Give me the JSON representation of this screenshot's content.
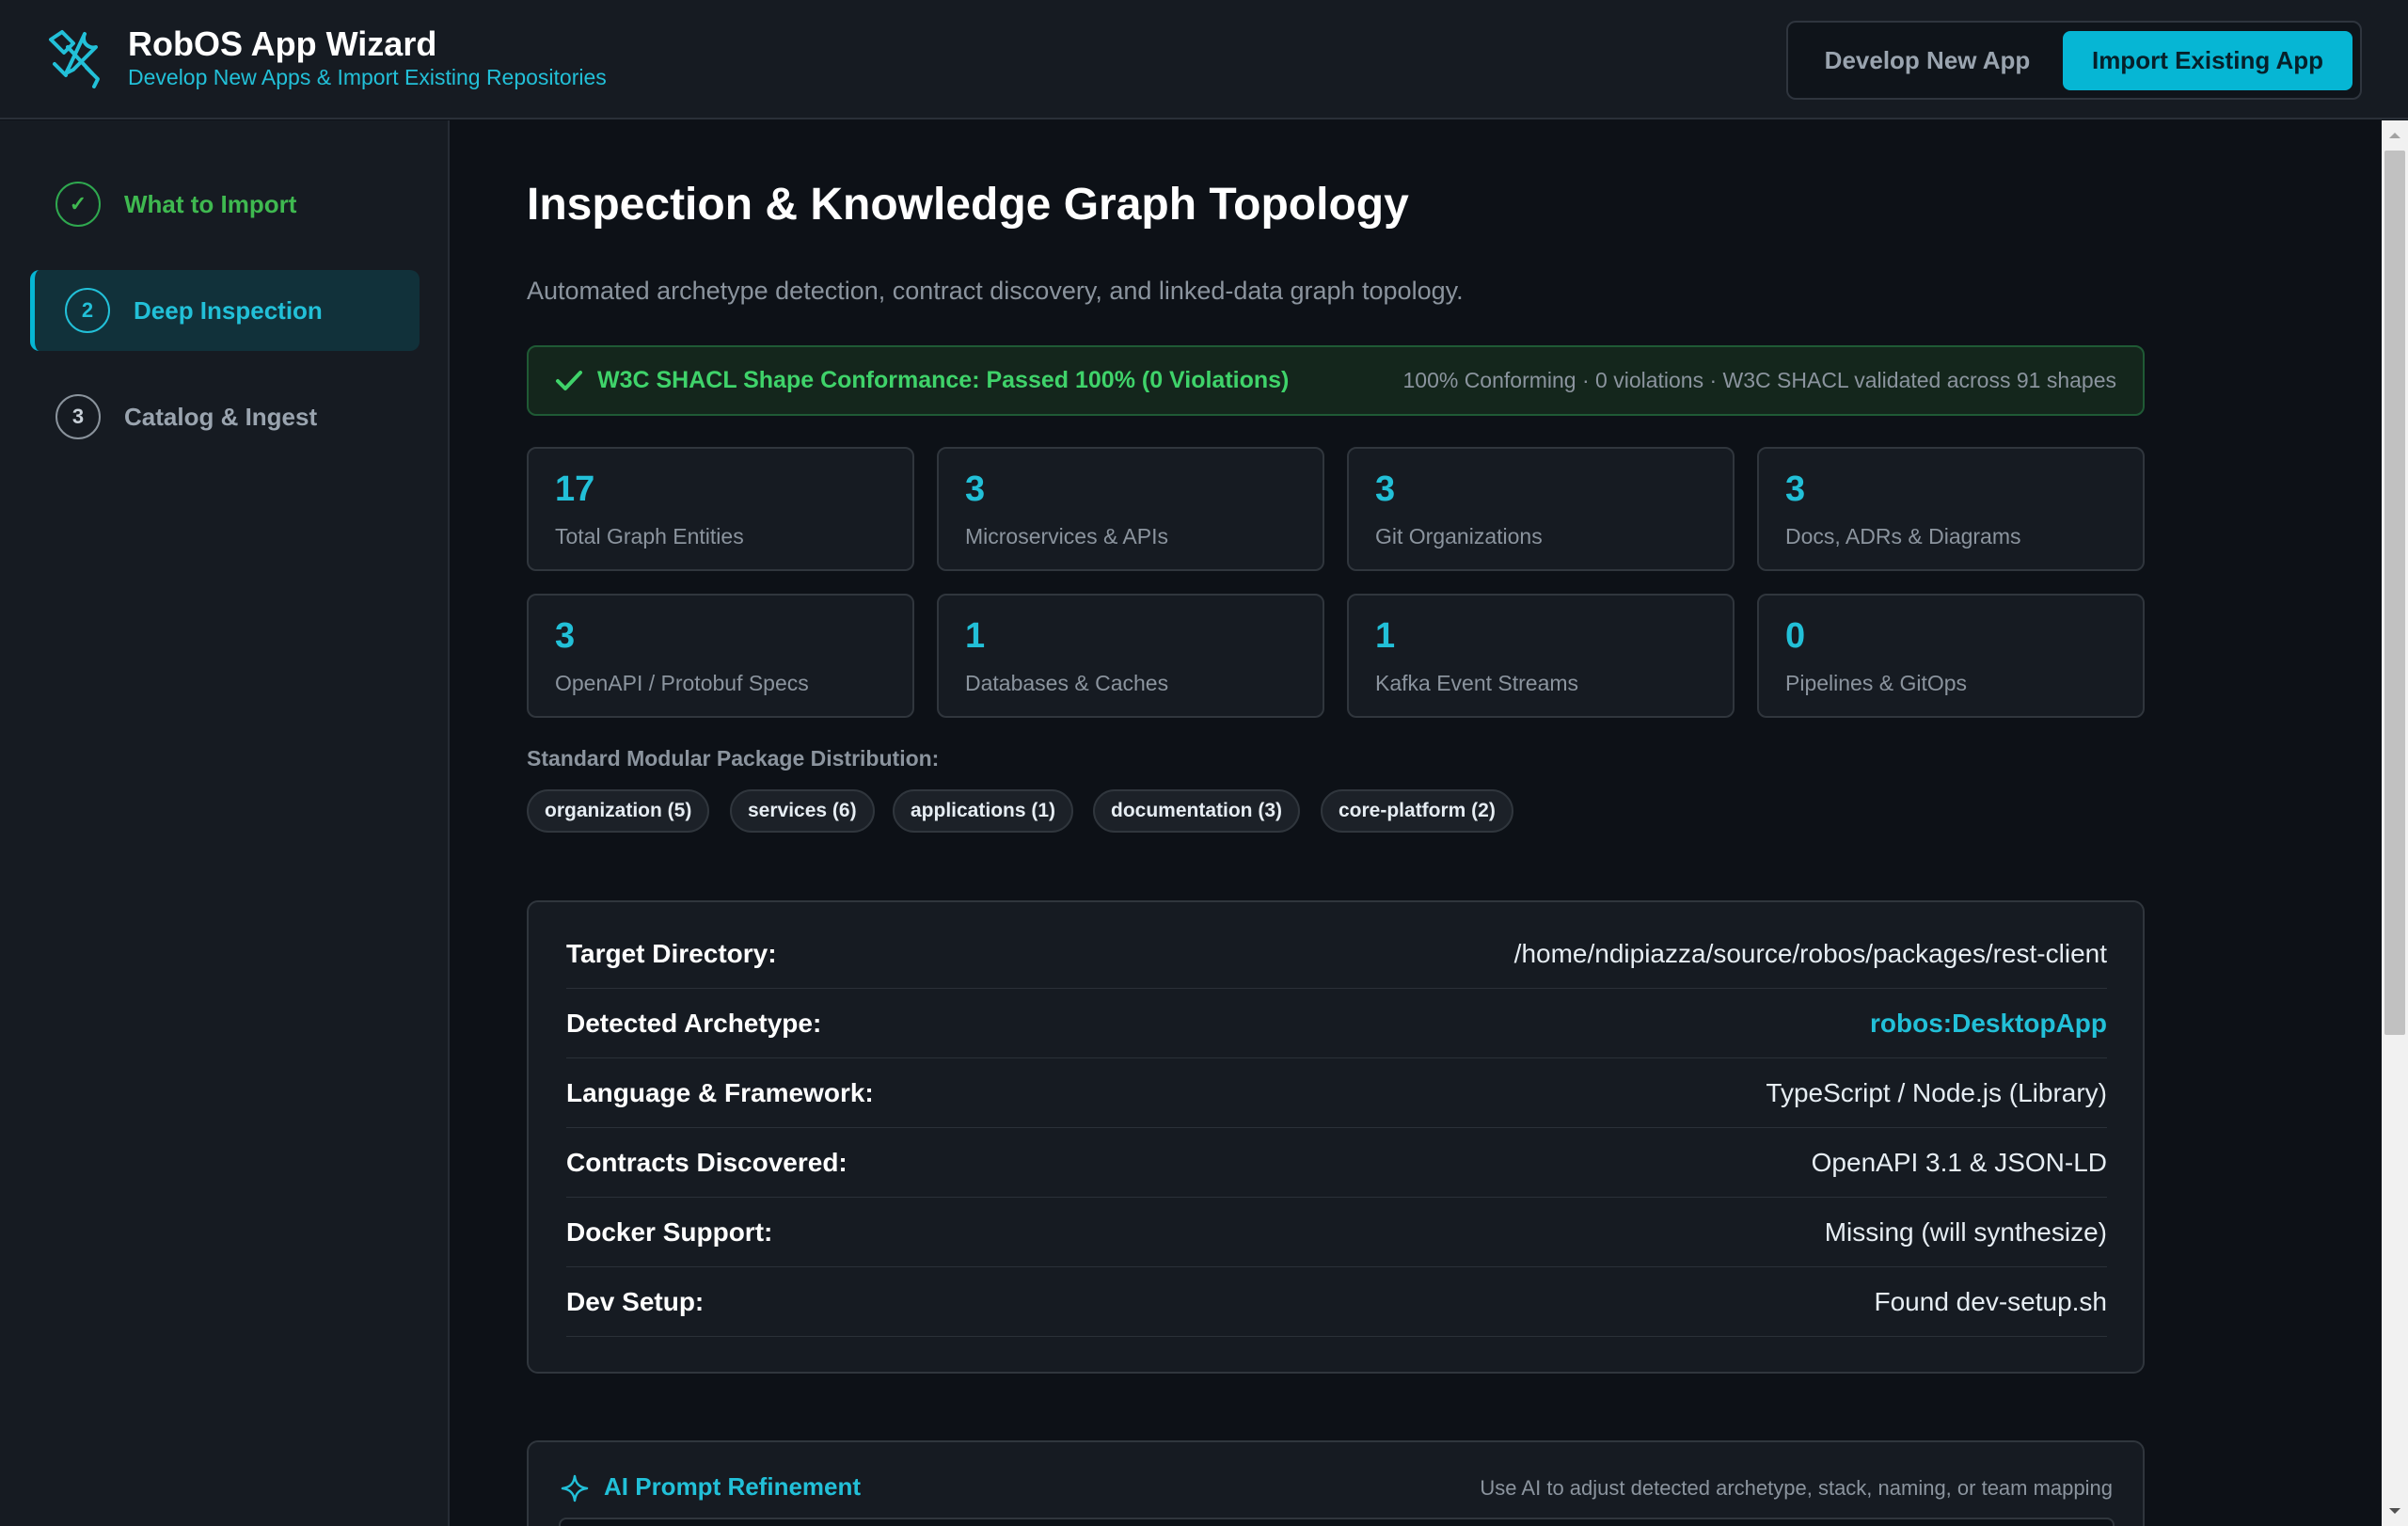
{
  "header": {
    "title": "RobOS App Wizard",
    "subtitle": "Develop New Apps & Import Existing Repositories",
    "modes": {
      "develop_label": "Develop New App",
      "import_label": "Import Existing App",
      "active": "import"
    },
    "logo_icon": "tools-icon"
  },
  "sidebar": {
    "steps": [
      {
        "marker": "✓",
        "label": "What to Import",
        "state": "done"
      },
      {
        "marker": "2",
        "label": "Deep Inspection",
        "state": "active"
      },
      {
        "marker": "3",
        "label": "Catalog & Ingest",
        "state": "pending"
      }
    ]
  },
  "main": {
    "title": "Inspection & Knowledge Graph Topology",
    "description": "Automated archetype detection, contract discovery, and linked-data graph topology.",
    "shacl": {
      "title": "W3C SHACL Shape Conformance: Passed 100% (0 Violations)",
      "meta": "100% Conforming · 0 violations · W3C SHACL validated across 91 shapes"
    },
    "stats": [
      {
        "value": "17",
        "label": "Total Graph Entities"
      },
      {
        "value": "3",
        "label": "Microservices & APIs"
      },
      {
        "value": "3",
        "label": "Git Organizations"
      },
      {
        "value": "3",
        "label": "Docs, ADRs & Diagrams"
      },
      {
        "value": "3",
        "label": "OpenAPI / Protobuf Specs"
      },
      {
        "value": "1",
        "label": "Databases & Caches"
      },
      {
        "value": "1",
        "label": "Kafka Event Streams"
      },
      {
        "value": "0",
        "label": "Pipelines & GitOps"
      }
    ],
    "distribution": {
      "title": "Standard Modular Package Distribution:",
      "packages": [
        "organization (5)",
        "services (6)",
        "applications (1)",
        "documentation (3)",
        "core-platform (2)"
      ]
    },
    "details": [
      {
        "key": "Target Directory:",
        "value": "/home/ndipiazza/source/robos/packages/rest-client"
      },
      {
        "key": "Detected Archetype:",
        "value": "robos:DesktopApp"
      },
      {
        "key": "Language & Framework:",
        "value": "TypeScript / Node.js (Library)"
      },
      {
        "key": "Contracts Discovered:",
        "value": "OpenAPI 3.1 & JSON-LD"
      },
      {
        "key": "Docker Support:",
        "value": "Missing (will synthesize)"
      },
      {
        "key": "Dev Setup:",
        "value": "Found dev-setup.sh"
      }
    ],
    "ai_refinement": {
      "title": "AI Prompt Refinement",
      "hint": "Use AI to adjust detected archetype, stack, naming, or team mapping"
    }
  },
  "colors": {
    "accent": "#06b6d4",
    "success": "#3fb950",
    "background": "#0d1117",
    "panel": "#161b22"
  }
}
